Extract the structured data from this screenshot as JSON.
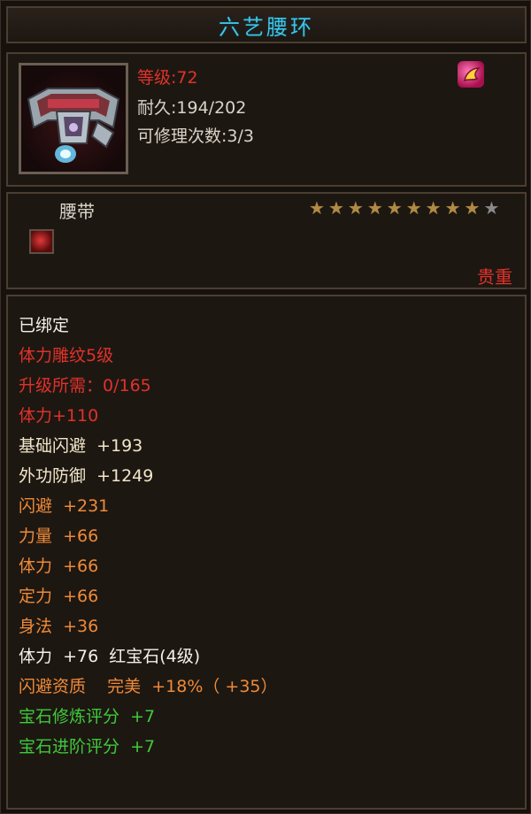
{
  "title": "六艺腰环",
  "item": {
    "icon": "belt-item-icon",
    "level_label": "等级:72",
    "durability_label": "耐久:194/202",
    "repair_label": "可修理次数:3/3",
    "class_icon": "class-emblem-icon",
    "type": "腰带",
    "star_rating": 9,
    "star_max": 10,
    "gem_slot_icon": "red-gem-icon",
    "rarity": "贵重"
  },
  "attributes": [
    {
      "text": "已绑定",
      "color": "#f2f0ea"
    },
    {
      "text": "体力雕纹5级",
      "color": "#e0322a"
    },
    {
      "text": "升级所需：0/165",
      "color": "#e0322a"
    },
    {
      "text": "体力+110",
      "color": "#e0322a"
    },
    {
      "text": "基础闪避  +193",
      "color": "#f2e6c8"
    },
    {
      "text": "外功防御  +1249",
      "color": "#f2e6c8"
    },
    {
      "text": "闪避  +231",
      "color": "#ef8a38"
    },
    {
      "text": "力量  +66",
      "color": "#ef8a38"
    },
    {
      "text": "体力  +66",
      "color": "#ef8a38"
    },
    {
      "text": "定力  +66",
      "color": "#ef8a38"
    },
    {
      "text": "身法  +36",
      "color": "#ef8a38"
    },
    {
      "text": "体力  +76  红宝石(4级)",
      "color": "#f2f0ea"
    },
    {
      "text": "闪避资质    完美  +18%（ +35）",
      "color": "#ef8a38"
    },
    {
      "text": "宝石修炼评分  +7",
      "color": "#3fca3a"
    },
    {
      "text": "宝石进阶评分  +7",
      "color": "#3fca3a"
    }
  ]
}
